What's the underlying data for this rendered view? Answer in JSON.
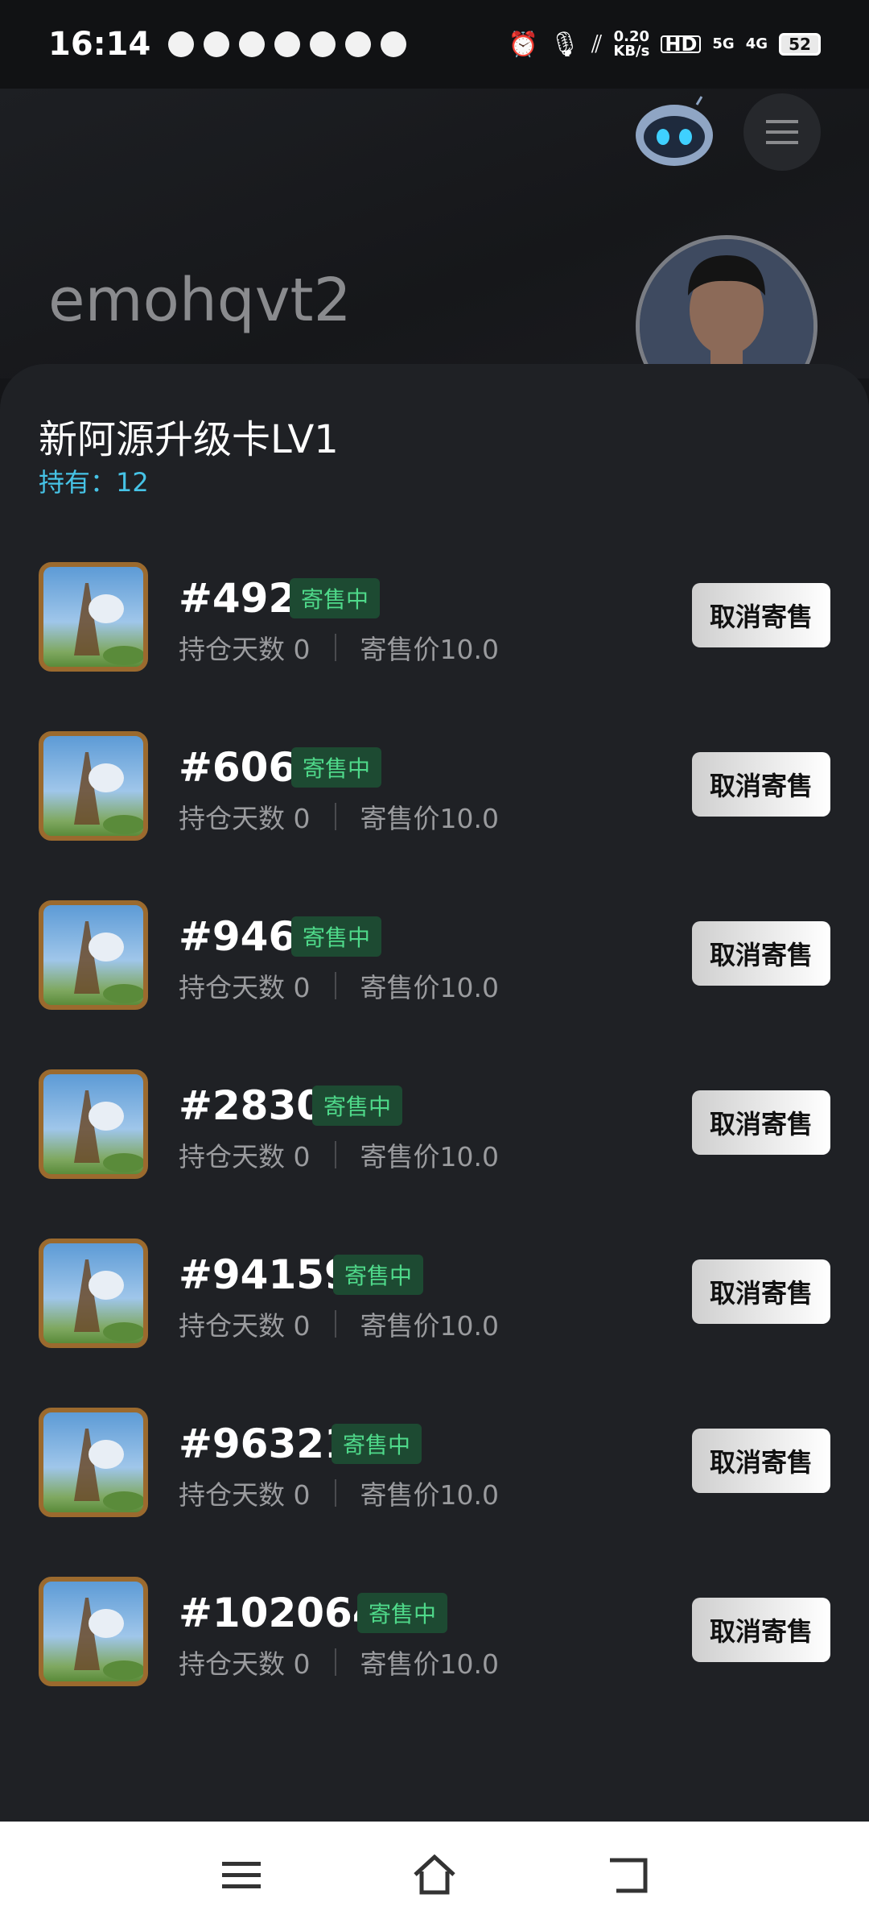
{
  "status_bar": {
    "time": "16:14",
    "net_speed_value": "0.20",
    "net_speed_unit": "KB/s",
    "hd_label": "HD",
    "signal_5g": "5G",
    "signal_4g": "4G",
    "battery": "52",
    "icons": [
      "wechat-icon",
      "message-icon",
      "qq-browser-icon",
      "camera-icon",
      "qq-icon",
      "app-icon",
      "alipay-icon",
      "alarm-icon",
      "mic-icon",
      "signal-icon"
    ]
  },
  "header": {
    "username": "emohqvt2"
  },
  "sheet": {
    "title": "新阿源升级卡LV1",
    "holding": "持有：12"
  },
  "items": [
    {
      "number": "#492",
      "status": "寄售中",
      "days": "持仓天数 0",
      "price": "寄售价10.0",
      "action": "取消寄售"
    },
    {
      "number": "#606",
      "status": "寄售中",
      "days": "持仓天数 0",
      "price": "寄售价10.0",
      "action": "取消寄售"
    },
    {
      "number": "#946",
      "status": "寄售中",
      "days": "持仓天数 0",
      "price": "寄售价10.0",
      "action": "取消寄售"
    },
    {
      "number": "#2830",
      "status": "寄售中",
      "days": "持仓天数 0",
      "price": "寄售价10.0",
      "action": "取消寄售"
    },
    {
      "number": "#94159",
      "status": "寄售中",
      "days": "持仓天数 0",
      "price": "寄售价10.0",
      "action": "取消寄售"
    },
    {
      "number": "#96321",
      "status": "寄售中",
      "days": "持仓天数 0",
      "price": "寄售价10.0",
      "action": "取消寄售"
    },
    {
      "number": "#102064",
      "status": "寄售中",
      "days": "持仓天数 0",
      "price": "寄售价10.0",
      "action": "取消寄售"
    }
  ],
  "colors": {
    "accent": "#46c3e6",
    "badge_text": "#4fd98a",
    "badge_bg": "#1d4a32",
    "sheet_bg": "#1f2125"
  },
  "navbar": {
    "icons": [
      "menu-icon",
      "home-icon",
      "back-icon"
    ]
  }
}
